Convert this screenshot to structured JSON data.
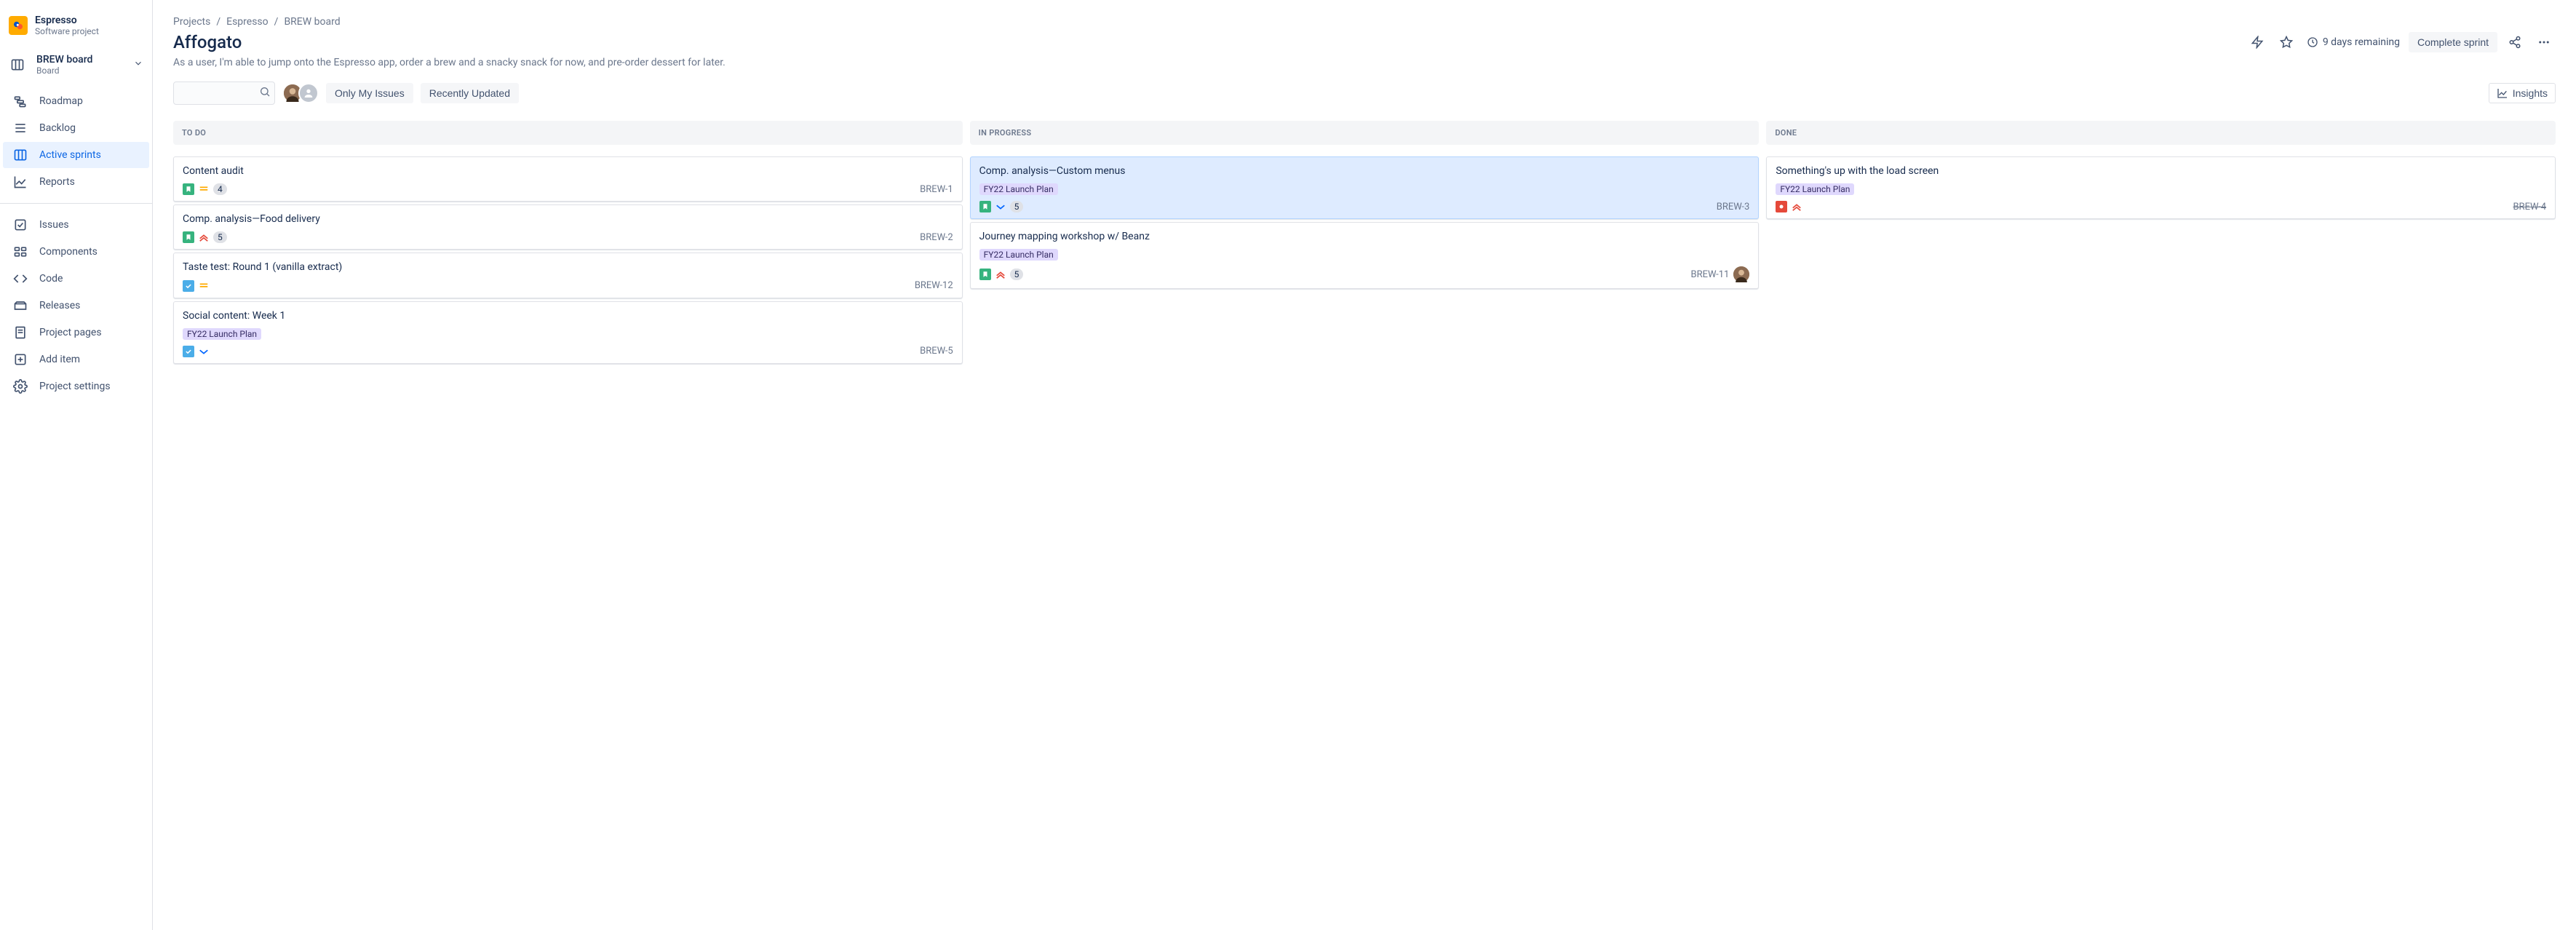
{
  "project": {
    "name": "Espresso",
    "subtitle": "Software project"
  },
  "board_selector": {
    "name": "BREW board",
    "type": "Board"
  },
  "nav_primary": [
    {
      "id": "roadmap",
      "label": "Roadmap",
      "icon": "roadmap"
    },
    {
      "id": "backlog",
      "label": "Backlog",
      "icon": "backlog"
    },
    {
      "id": "active-sprints",
      "label": "Active sprints",
      "icon": "board",
      "active": true
    },
    {
      "id": "reports",
      "label": "Reports",
      "icon": "reports"
    }
  ],
  "nav_secondary": [
    {
      "id": "issues",
      "label": "Issues",
      "icon": "issues"
    },
    {
      "id": "components",
      "label": "Components",
      "icon": "components"
    },
    {
      "id": "code",
      "label": "Code",
      "icon": "code"
    },
    {
      "id": "releases",
      "label": "Releases",
      "icon": "releases"
    },
    {
      "id": "project-pages",
      "label": "Project pages",
      "icon": "pages"
    },
    {
      "id": "add-item",
      "label": "Add item",
      "icon": "add"
    },
    {
      "id": "project-settings",
      "label": "Project settings",
      "icon": "settings"
    }
  ],
  "breadcrumb": [
    "Projects",
    "Espresso",
    "BREW board"
  ],
  "page_title": "Affogato",
  "description": "As a user, I'm able to jump onto the Espresso app, order a brew and a snacky snack for now, and pre-order dessert for later.",
  "header": {
    "days_remaining": "9 days remaining",
    "complete_label": "Complete sprint"
  },
  "toolbar": {
    "search_placeholder": "",
    "only_my_issues": "Only My Issues",
    "recently_updated": "Recently Updated",
    "insights_label": "Insights",
    "avatars": [
      {
        "bg": "#A5815A",
        "initials": ""
      },
      {
        "bg": "#C1C7D0",
        "initials": ""
      }
    ]
  },
  "columns": [
    {
      "id": "todo",
      "title": "TO DO",
      "cards": [
        {
          "title": "Content audit",
          "type": "story",
          "priority": "medium",
          "points": "4",
          "key": "BREW-1"
        },
        {
          "title": "Comp. analysis—Food delivery",
          "type": "story",
          "priority": "high",
          "points": "5",
          "key": "BREW-2"
        },
        {
          "title": "Taste test: Round 1 (vanilla extract)",
          "type": "task",
          "priority": "medium",
          "key": "BREW-12"
        },
        {
          "title": "Social content: Week 1",
          "epic": "FY22 Launch Plan",
          "type": "task",
          "priority": "low",
          "key": "BREW-5"
        }
      ]
    },
    {
      "id": "inprogress",
      "title": "IN PROGRESS",
      "cards": [
        {
          "title": "Comp. analysis—Custom menus",
          "epic": "FY22 Launch Plan",
          "type": "story",
          "priority": "low",
          "points": "5",
          "key": "BREW-3",
          "highlight": true
        },
        {
          "title": "Journey mapping workshop w/ Beanz",
          "epic": "FY22 Launch Plan",
          "type": "story",
          "priority": "high",
          "points": "5",
          "key": "BREW-11",
          "assignee": {
            "bg": "#A5815A"
          }
        }
      ]
    },
    {
      "id": "done",
      "title": "DONE",
      "cards": [
        {
          "title": "Something's up with the load screen",
          "epic": "FY22 Launch Plan",
          "type": "bug",
          "priority": "high",
          "key": "BREW-4",
          "done": true
        }
      ]
    }
  ]
}
